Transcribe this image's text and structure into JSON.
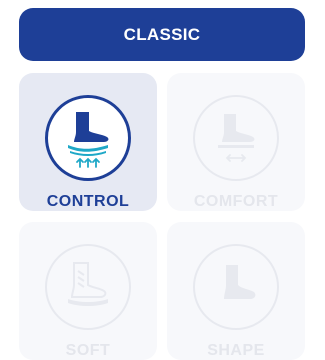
{
  "header": {
    "title": "CLASSIC"
  },
  "options": [
    {
      "label": "CONTROL",
      "icon": "foot-arch-support-icon",
      "state": "selected"
    },
    {
      "label": "COMFORT",
      "icon": "foot-cushion-icon",
      "state": "unselected"
    },
    {
      "label": "SOFT",
      "icon": "foot-soft-icon",
      "state": "unselected"
    },
    {
      "label": "SHAPE",
      "icon": "foot-shape-icon",
      "state": "unselected"
    }
  ],
  "colors": {
    "accent": "#1e3f97",
    "teal": "#1fa8c7",
    "selected_bg": "#e6e9f3",
    "unselected_bg": "#f7f8fb",
    "unselected_fg": "#e4e6ec"
  }
}
